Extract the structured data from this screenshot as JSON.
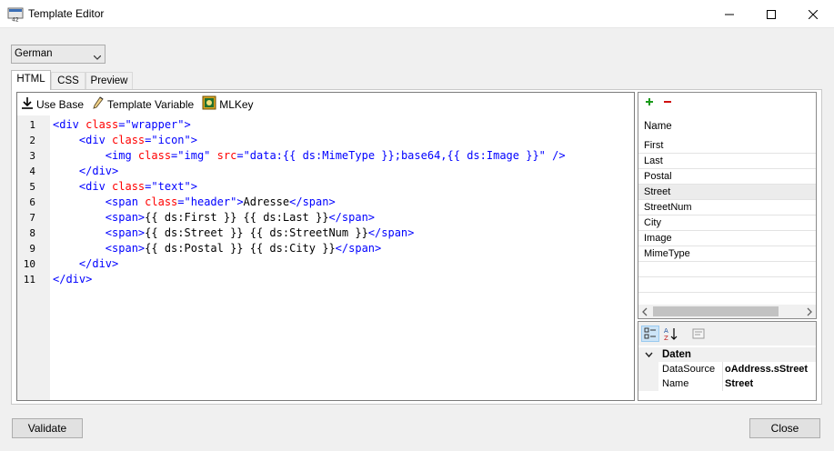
{
  "window": {
    "title": "Template Editor"
  },
  "language_select": {
    "value": "German"
  },
  "tabs": [
    {
      "label": "HTML",
      "active": true
    },
    {
      "label": "CSS",
      "active": false
    },
    {
      "label": "Preview",
      "active": false
    }
  ],
  "editor_toolbar": {
    "use_base": "Use Base",
    "template_variable": "Template Variable",
    "mlkey": "MLKey"
  },
  "code_lines": [
    {
      "n": "1",
      "segments": [
        [
          "tag",
          "<div "
        ],
        [
          "attr",
          "class"
        ],
        [
          "tag",
          "="
        ],
        [
          "str",
          "\"wrapper\""
        ],
        [
          "tag",
          ">"
        ]
      ]
    },
    {
      "n": "2",
      "segments": [
        [
          "txt",
          "    "
        ],
        [
          "tag",
          "<div "
        ],
        [
          "attr",
          "class"
        ],
        [
          "tag",
          "="
        ],
        [
          "str",
          "\"icon\""
        ],
        [
          "tag",
          ">"
        ]
      ]
    },
    {
      "n": "3",
      "segments": [
        [
          "txt",
          "        "
        ],
        [
          "tag",
          "<img "
        ],
        [
          "attr",
          "class"
        ],
        [
          "tag",
          "="
        ],
        [
          "str",
          "\"img\" "
        ],
        [
          "attr",
          "src"
        ],
        [
          "tag",
          "="
        ],
        [
          "str",
          "\"data:{{ ds:MimeType }};base64,{{ ds:Image }}\""
        ],
        [
          "tag",
          " />"
        ]
      ]
    },
    {
      "n": "4",
      "segments": [
        [
          "txt",
          "    "
        ],
        [
          "tag",
          "</div>"
        ]
      ]
    },
    {
      "n": "5",
      "segments": [
        [
          "txt",
          "    "
        ],
        [
          "tag",
          "<div "
        ],
        [
          "attr",
          "class"
        ],
        [
          "tag",
          "="
        ],
        [
          "str",
          "\"text\""
        ],
        [
          "tag",
          ">"
        ]
      ]
    },
    {
      "n": "6",
      "segments": [
        [
          "txt",
          "        "
        ],
        [
          "tag",
          "<span "
        ],
        [
          "attr",
          "class"
        ],
        [
          "tag",
          "="
        ],
        [
          "str",
          "\"header\""
        ],
        [
          "tag",
          ">"
        ],
        [
          "txt",
          "Adresse"
        ],
        [
          "tag",
          "</span>"
        ]
      ]
    },
    {
      "n": "7",
      "segments": [
        [
          "txt",
          "        "
        ],
        [
          "tag",
          "<span>"
        ],
        [
          "txt",
          "{{ ds:First }} {{ ds:Last }}"
        ],
        [
          "tag",
          "</span>"
        ]
      ]
    },
    {
      "n": "8",
      "segments": [
        [
          "txt",
          "        "
        ],
        [
          "tag",
          "<span>"
        ],
        [
          "txt",
          "{{ ds:Street }} {{ ds:StreetNum }}"
        ],
        [
          "tag",
          "</span>"
        ]
      ]
    },
    {
      "n": "9",
      "segments": [
        [
          "txt",
          "        "
        ],
        [
          "tag",
          "<span>"
        ],
        [
          "txt",
          "{{ ds:Postal }} {{ ds:City }}"
        ],
        [
          "tag",
          "</span>"
        ]
      ]
    },
    {
      "n": "10",
      "segments": [
        [
          "txt",
          "    "
        ],
        [
          "tag",
          "</div>"
        ]
      ]
    },
    {
      "n": "11",
      "segments": [
        [
          "tag",
          "</div>"
        ]
      ]
    }
  ],
  "syntax_colors": {
    "tag": "#0000ff",
    "attr": "#ff0000",
    "str": "#0000ff",
    "txt": "#000000"
  },
  "variables_grid": {
    "header": "Name",
    "rows": [
      "First",
      "Last",
      "Postal",
      "Street",
      "StreetNum",
      "City",
      "Image",
      "MimeType"
    ],
    "selected": "Street"
  },
  "properties": {
    "category": "Daten",
    "rows": [
      {
        "name": "DataSource",
        "value": "oAddress.sStreet"
      },
      {
        "name": "Name",
        "value": "Street"
      }
    ]
  },
  "buttons": {
    "validate": "Validate",
    "close": "Close"
  }
}
